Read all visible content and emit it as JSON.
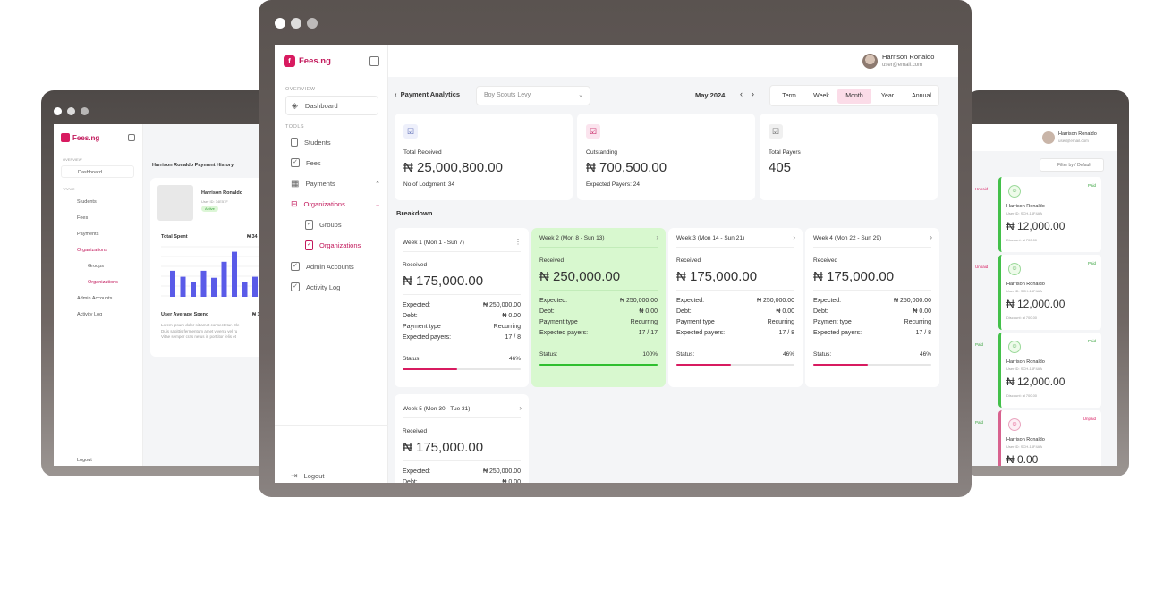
{
  "app": {
    "brand": "Fees.ng"
  },
  "user": {
    "name": "Harrison Ronaldo",
    "email": "user@email.com"
  },
  "sidebar": {
    "overview_label": "OVERVIEW",
    "dashboard": "Dashboard",
    "tools_label": "TOOLS",
    "items": [
      "Students",
      "Fees",
      "Payments",
      "Organizations"
    ],
    "sub_items": [
      "Groups",
      "Organizations"
    ],
    "items2": [
      "Admin Accounts",
      "Activity Log"
    ],
    "logout": "Logout"
  },
  "left_window": {
    "header": "Harrison Ronaldo  Payment History",
    "profile_name": "Harrison Ronaldo",
    "profile_id": "User ID: 34E57F",
    "status": "Active",
    "total_spent": "Total Spent",
    "total_value": "₦ 34",
    "avg_spend": "User Average Spend",
    "avg_value": "₦ 1",
    "lorem": [
      "Lorem ipsum dolor sit amet consectetur. Ele",
      "Duis sagittis fermentum amet viverra vel ru",
      "Vitae semper cras netus in porttitor felis et"
    ],
    "chart_data": {
      "type": "bar",
      "values": [
        52,
        40,
        30,
        52,
        38,
        70,
        90,
        30,
        40,
        88
      ]
    }
  },
  "main": {
    "title": "Payment Analytics",
    "select_value": "Boy Scouts Levy",
    "period": "May 2024",
    "tabs": [
      "Term",
      "Week",
      "Month",
      "Year",
      "Annual"
    ],
    "active_tab": "Month",
    "stats": [
      {
        "label": "Total Received",
        "value": "₦ 25,000,800.00",
        "sub": "No of Lodgment: 34"
      },
      {
        "label": "Outstanding",
        "value": "₦ 700,500.00",
        "sub": "Expected Payers: 24"
      },
      {
        "label": "Total Payers",
        "value": "405",
        "sub": ""
      }
    ],
    "breakdown_title": "Breakdown",
    "weeks": [
      {
        "title": "Week 1 (Mon 1 - Sun 7)",
        "received_label": "Received",
        "received": "₦ 175,000.00",
        "expected": "₦ 250,000.00",
        "debt": "₦ 0.00",
        "type": "Recurring",
        "payers": "17 / 8",
        "status": "46%",
        "progress": 0.46
      },
      {
        "title": "Week 2 (Mon 8 - Sun 13)",
        "received_label": "Received",
        "received": "₦ 250,000.00",
        "expected": "₦ 250,000.00",
        "debt": "₦ 0.00",
        "type": "Recurring",
        "payers": "17 / 17",
        "status": "100%",
        "progress": 1.0
      },
      {
        "title": "Week 3 (Mon 14 - Sun 21)",
        "received_label": "Received",
        "received": "₦ 175,000.00",
        "expected": "₦ 250,000.00",
        "debt": "₦ 0.00",
        "type": "Recurring",
        "payers": "17 / 8",
        "status": "46%",
        "progress": 0.46
      },
      {
        "title": "Week 4 (Mon 22 - Sun 29)",
        "received_label": "Received",
        "received": "₦ 175,000.00",
        "expected": "₦ 250,000.00",
        "debt": "₦ 0.00",
        "type": "Recurring",
        "payers": "17 / 8",
        "status": "46%",
        "progress": 0.46
      },
      {
        "title": "Week 5 (Mon 30 - Tue 31)",
        "received_label": "Received",
        "received": "₦ 175,000.00",
        "expected": "₦ 250,000.00",
        "debt": "₦ 0.00",
        "type": "",
        "payers": "",
        "status": "",
        "progress": 0
      }
    ],
    "labels": {
      "expected": "Expected:",
      "debt": "Debt:",
      "type": "Payment type",
      "payers": "Expected payers:",
      "status": "Status:"
    }
  },
  "right_window": {
    "filter": "Filter by / Default",
    "cards": [
      {
        "name": "Harrison Ronaldo",
        "id": "User ID: SCH-14F4AA",
        "badge": "Paid",
        "amount": "₦ 12,000.00",
        "foot": "Discount: ₦ 700.00",
        "left_badge": "Unpaid"
      },
      {
        "name": "Harrison Ronaldo",
        "id": "User ID: SCH-14F4AA",
        "badge": "Paid",
        "amount": "₦ 12,000.00",
        "foot": "Discount: ₦ 700.00",
        "left_badge": "Unpaid"
      },
      {
        "name": "Harrison Ronaldo",
        "id": "User ID: SCH-14F4AA",
        "badge": "Paid",
        "amount": "₦ 12,000.00",
        "foot": "Discount: ₦ 700.00",
        "left_badge": "Paid"
      },
      {
        "name": "Harrison Ronaldo",
        "id": "User ID: SCH-14F4AA",
        "badge": "Unpaid",
        "amount": "₦ 0.00",
        "foot": "",
        "left_badge": "Paid"
      }
    ]
  },
  "colors": {
    "accent": "#d81b60",
    "paid": "#43c04a",
    "paid_bg": "#d8f8cf"
  }
}
